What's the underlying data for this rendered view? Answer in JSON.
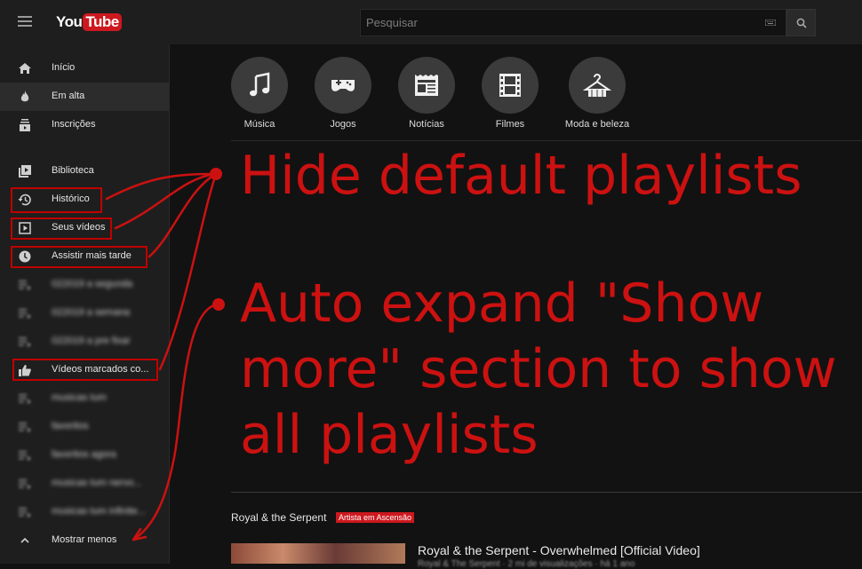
{
  "header": {
    "logo_you": "You",
    "logo_tube": "Tube",
    "search_placeholder": "Pesquisar"
  },
  "sidebar": {
    "items": [
      {
        "label": "Início",
        "icon": "home-icon"
      },
      {
        "label": "Em alta",
        "icon": "flame-icon"
      },
      {
        "label": "Inscrições",
        "icon": "subscriptions-icon"
      },
      {
        "label": "Biblioteca",
        "icon": "library-icon"
      },
      {
        "label": "Histórico",
        "icon": "history-icon"
      },
      {
        "label": "Seus vídeos",
        "icon": "video-icon"
      },
      {
        "label": "Assistir mais tarde",
        "icon": "clock-icon"
      },
      {
        "label": "022019 a segunda",
        "icon": "playlist-icon"
      },
      {
        "label": "022019 a semana",
        "icon": "playlist-icon"
      },
      {
        "label": "022019 a pre fixar",
        "icon": "playlist-icon"
      },
      {
        "label": "Vídeos marcados co...",
        "icon": "thumbs-up-icon"
      },
      {
        "label": "musicas tum",
        "icon": "playlist-icon"
      },
      {
        "label": "favoritos",
        "icon": "playlist-icon"
      },
      {
        "label": "favoritos agora",
        "icon": "playlist-icon"
      },
      {
        "label": "musicas tum nervo...",
        "icon": "playlist-icon"
      },
      {
        "label": "musicas tum infinite...",
        "icon": "playlist-icon"
      },
      {
        "label": "Mostrar menos",
        "icon": "chevron-up-icon"
      }
    ]
  },
  "categories": [
    {
      "label": "Música",
      "icon": "music-note-icon"
    },
    {
      "label": "Jogos",
      "icon": "gamepad-icon"
    },
    {
      "label": "Notícias",
      "icon": "newspaper-icon"
    },
    {
      "label": "Filmes",
      "icon": "film-icon"
    },
    {
      "label": "Moda e beleza",
      "icon": "hanger-icon"
    }
  ],
  "annotations": {
    "hide_playlists": "Hide default playlists",
    "auto_expand_line1": "Auto expand \"Show",
    "auto_expand_line2": "more\" section to show",
    "auto_expand_line3": "all playlists",
    "color": "#cc1111"
  },
  "feed": {
    "channel_name": "Royal & the Serpent",
    "badge": "Artista em Ascensão",
    "video_title": "Royal & the Serpent - Overwhelmed [Official Video]",
    "video_subtitle": "Royal & The Serpent · 2 mi de visualizações · há 1 ano"
  },
  "colors": {
    "background": "#121212",
    "sidebar": "#1e1e1e",
    "accent": "#cc181e",
    "annotation": "#cc1111"
  }
}
